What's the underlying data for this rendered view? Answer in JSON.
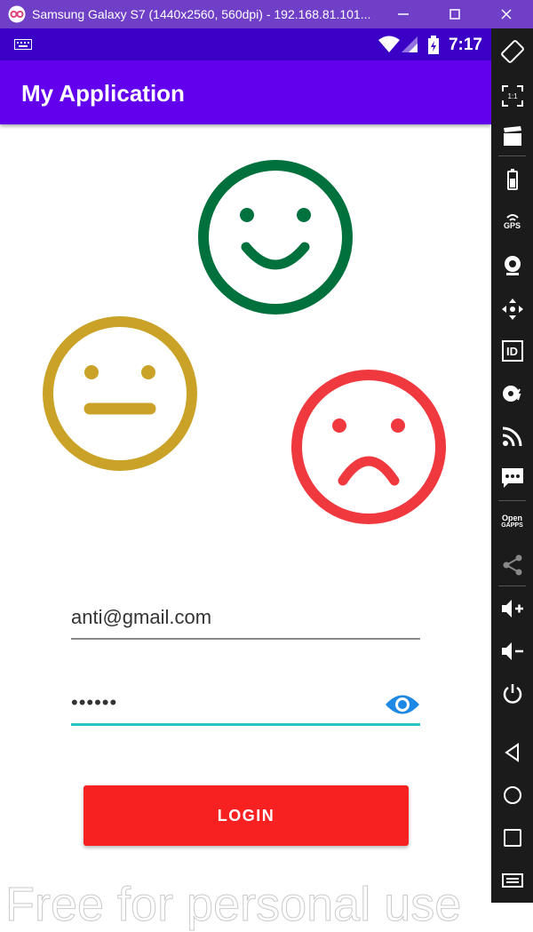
{
  "window": {
    "title": "Samsung Galaxy S7 (1440x2560, 560dpi) - 192.168.81.101..."
  },
  "status_bar": {
    "time": "7:17",
    "icons": [
      "keyboard-icon",
      "wifi-icon",
      "signal-icon",
      "battery-charging-icon"
    ]
  },
  "app_bar": {
    "title": "My Application"
  },
  "faces": [
    {
      "name": "happy",
      "color": "#00703c"
    },
    {
      "name": "neutral",
      "color": "#c9a227"
    },
    {
      "name": "sad",
      "color": "#f0393e"
    }
  ],
  "form": {
    "email_value": "anti@gmail.com",
    "password_masked": "••••••",
    "login_label": "LOGIN"
  },
  "colors": {
    "app_bar": "#6200ee",
    "status_bar": "#3b00c6",
    "accent": "#26c4c4",
    "login_button": "#f72121"
  },
  "watermark": "Free for personal use",
  "emulator_toolbar": {
    "items": [
      "rotate-icon",
      "fullscreen-icon",
      "clapper-icon",
      "battery-icon",
      "gps-icon",
      "camera-icon",
      "dpad-icon",
      "id-icon",
      "disk-icon",
      "cast-icon",
      "sms-icon",
      "opengapps-icon",
      "share-icon",
      "volume-up-icon",
      "volume-down-icon",
      "power-icon",
      "back-icon",
      "home-icon",
      "recents-icon",
      "menu-icon"
    ],
    "gps_label": "GPS",
    "id_label": "ID",
    "opengapps_label_line1": "Open",
    "opengapps_label_line2": "GAPPS"
  }
}
